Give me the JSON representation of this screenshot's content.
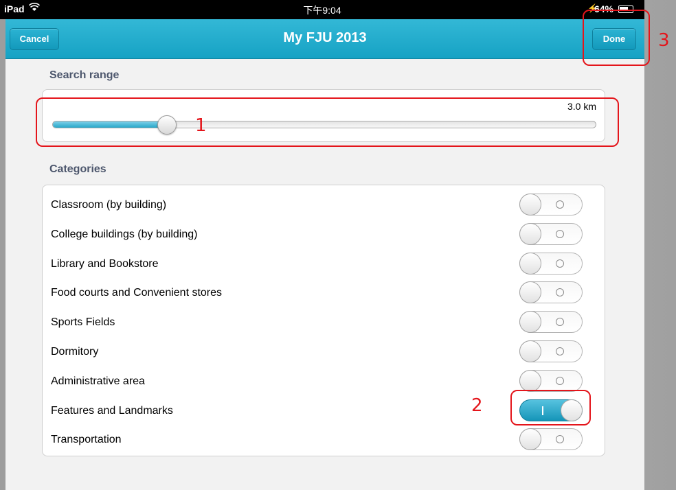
{
  "status_bar": {
    "device": "iPad",
    "wifi_icon": "wifi-icon",
    "time": "下午9:04",
    "battery": "64%"
  },
  "nav": {
    "title": "My FJU 2013",
    "cancel_label": "Cancel",
    "done_label": "Done"
  },
  "search_range": {
    "section_label": "Search range",
    "value_text": "3.0 km",
    "slider_fraction": 0.21
  },
  "categories": {
    "section_label": "Categories",
    "items": [
      {
        "label": "Classroom (by building)",
        "on": false
      },
      {
        "label": "College buildings (by building)",
        "on": false
      },
      {
        "label": "Library and Bookstore",
        "on": false
      },
      {
        "label": "Food courts and Convenient stores",
        "on": false
      },
      {
        "label": "Sports Fields",
        "on": false
      },
      {
        "label": "Dormitory",
        "on": false
      },
      {
        "label": "Administrative area",
        "on": false
      },
      {
        "label": "Features and Landmarks",
        "on": true
      },
      {
        "label": "Transportation",
        "on": false
      }
    ]
  },
  "annotations": {
    "one": "1",
    "two": "2",
    "three": "3",
    "color": "#e4151b"
  },
  "colors": {
    "accent": "#1aa6c8"
  }
}
